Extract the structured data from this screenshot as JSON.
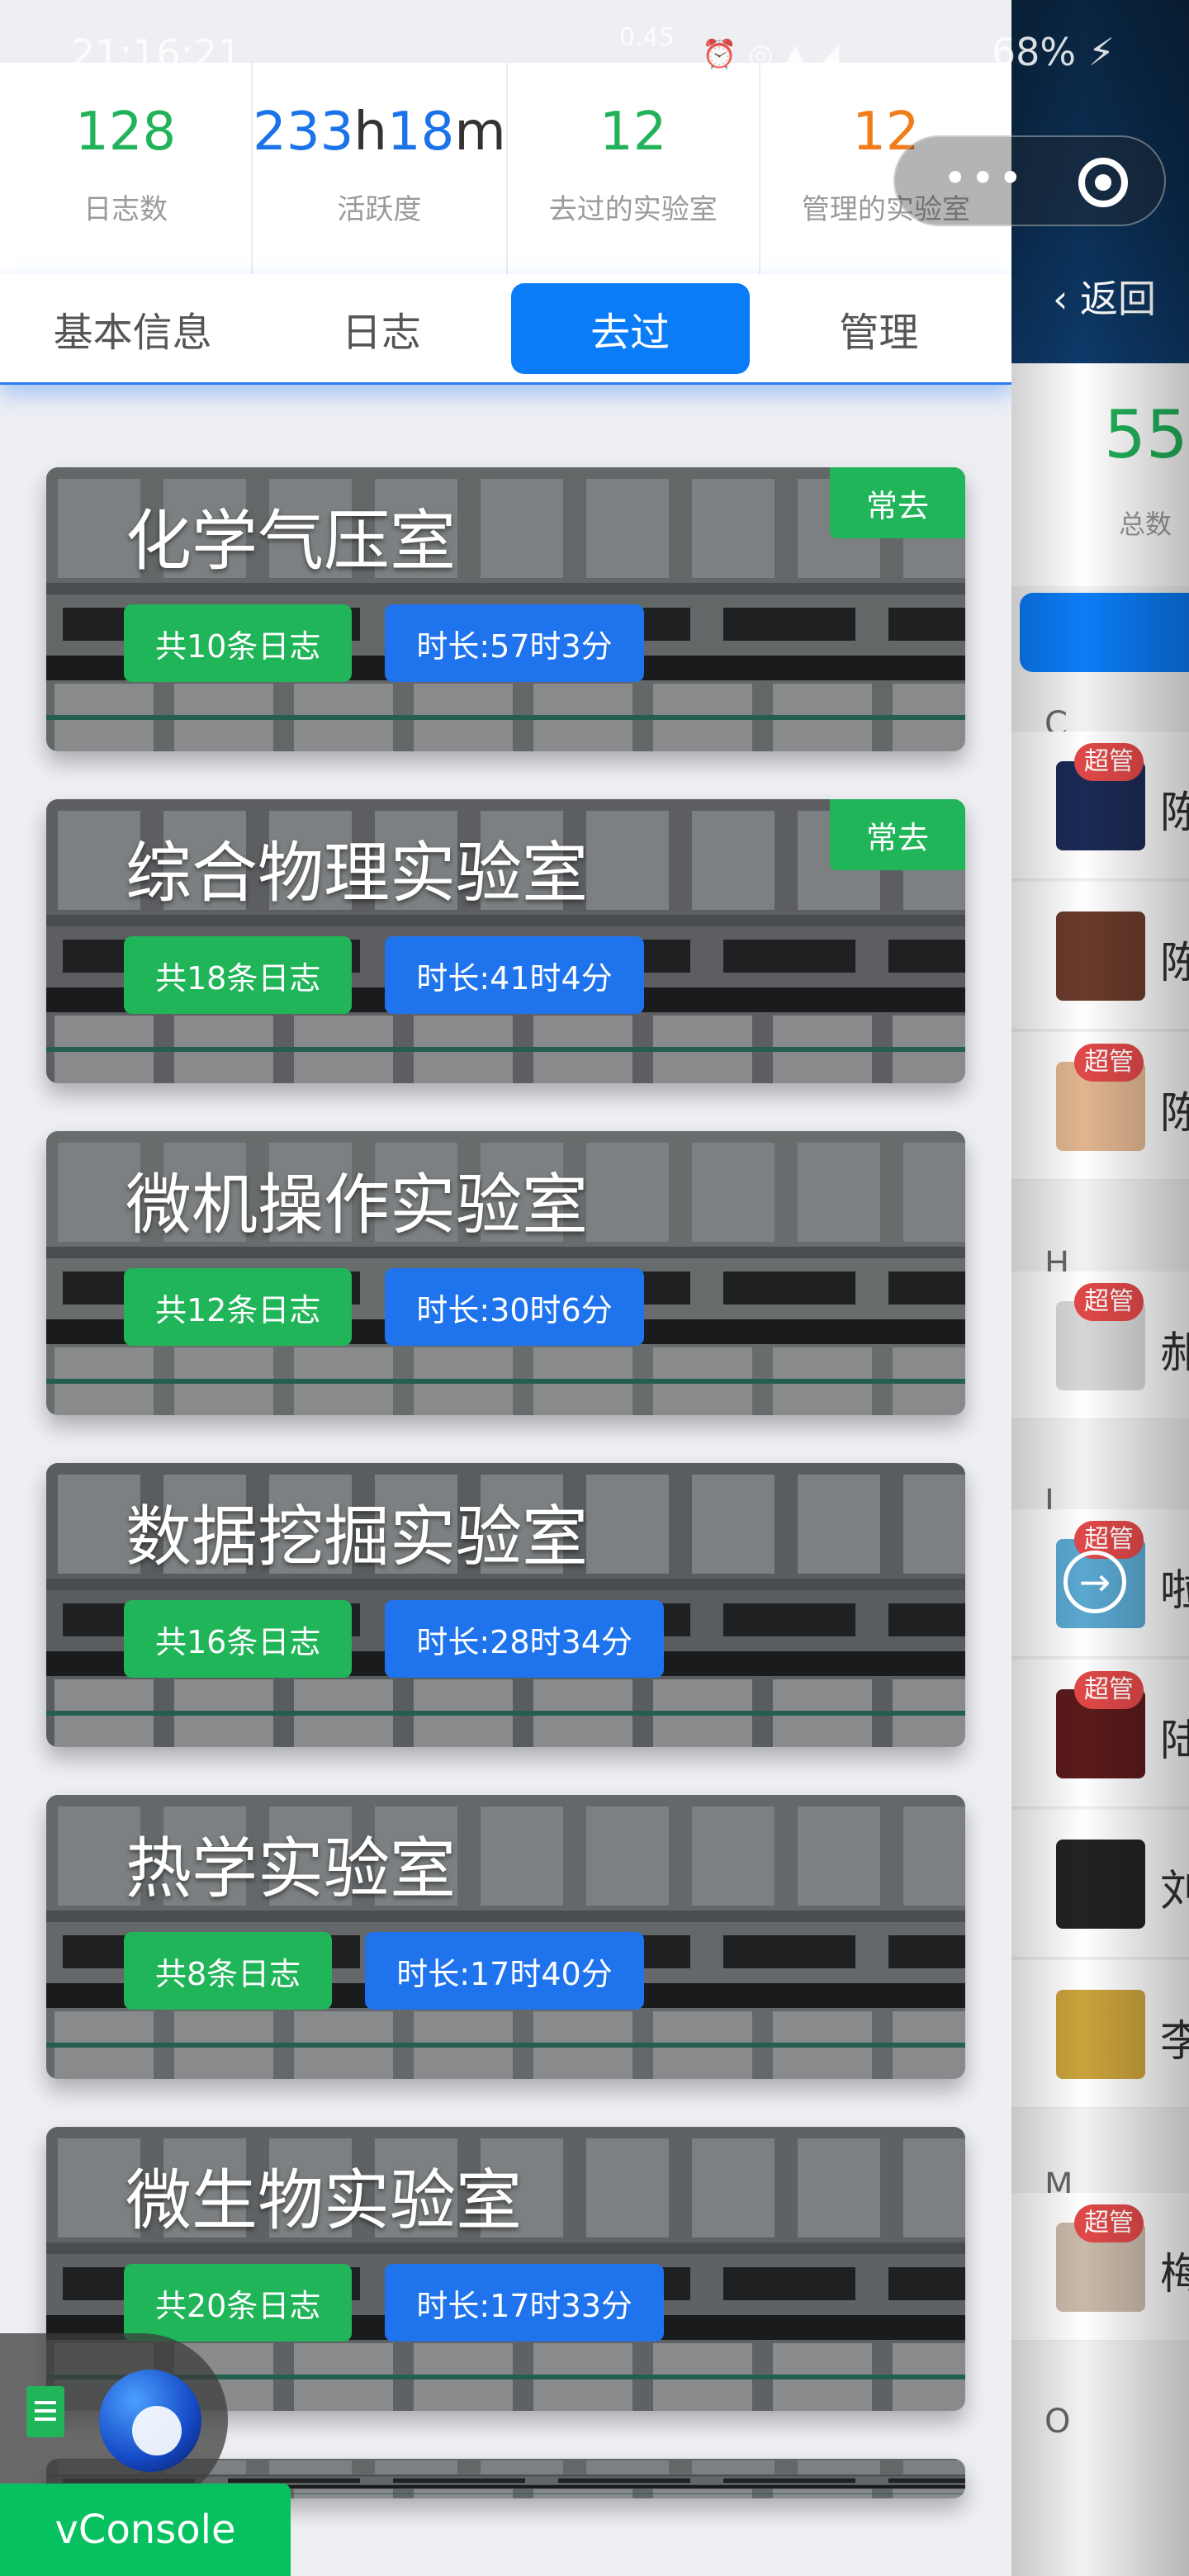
{
  "status_bar": {
    "time": "21:16:21",
    "net_speed": "0.45",
    "battery": "68%"
  },
  "stats": [
    {
      "value": "128",
      "label": "日志数",
      "color": "green"
    },
    {
      "value_parts": [
        "233",
        "h",
        "18",
        "m"
      ],
      "label": "活跃度",
      "color": "blue"
    },
    {
      "value": "12",
      "label": "去过的实验室",
      "color": "green"
    },
    {
      "value": "12",
      "label": "管理的实验室",
      "color": "orange"
    }
  ],
  "tabs": [
    "基本信息",
    "日志",
    "去过",
    "管理"
  ],
  "active_tab": "去过",
  "labs": [
    {
      "name": "化学气压室",
      "logs": "共10条日志",
      "duration": "时长:57时3分",
      "tag": "常去"
    },
    {
      "name": "综合物理实验室",
      "logs": "共18条日志",
      "duration": "时长:41时4分",
      "tag": "常去"
    },
    {
      "name": "微机操作实验室",
      "logs": "共12条日志",
      "duration": "时长:30时6分",
      "tag": ""
    },
    {
      "name": "数据挖掘实验室",
      "logs": "共16条日志",
      "duration": "时长:28时34分",
      "tag": ""
    },
    {
      "name": "热学实验室",
      "logs": "共8条日志",
      "duration": "时长:17时40分",
      "tag": ""
    },
    {
      "name": "微生物实验室",
      "logs": "共20条日志",
      "duration": "时长:17时33分",
      "tag": ""
    }
  ],
  "side": {
    "back_label": "返回",
    "total_value": "55",
    "total_label": "总数",
    "letters": [
      "C",
      "H",
      "L",
      "M",
      "O"
    ],
    "members": [
      {
        "name": "陈",
        "tag": "超管"
      },
      {
        "name": "陈",
        "tag": ""
      },
      {
        "name": "陈",
        "tag": "超管"
      },
      {
        "name": "郝",
        "tag": "超管"
      },
      {
        "name": "啦",
        "tag": "超管"
      },
      {
        "name": "陆",
        "tag": "超管"
      },
      {
        "name": "刘",
        "tag": ""
      },
      {
        "name": "李",
        "tag": ""
      },
      {
        "name": "梅",
        "tag": "超管"
      }
    ]
  },
  "vconsole_label": "vConsole",
  "colors": {
    "green": "#22b25a",
    "blue": "#1a73e8",
    "orange": "#f07c1a",
    "tab_active": "#0b7cf7"
  }
}
